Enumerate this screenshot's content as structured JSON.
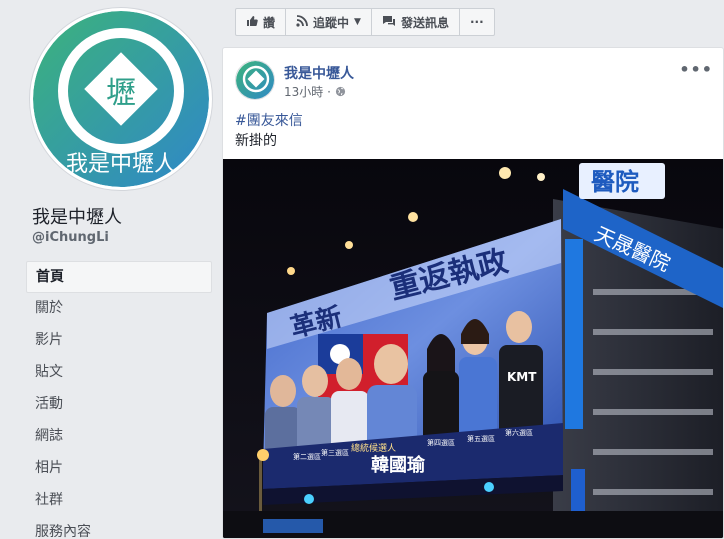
{
  "page": {
    "name": "我是中壢人",
    "handle": "@iChungLi",
    "logo_text": "我是中壢人",
    "logo_char": "壢"
  },
  "nav": {
    "items": [
      {
        "label": "首頁",
        "active": true
      },
      {
        "label": "關於"
      },
      {
        "label": "影片"
      },
      {
        "label": "貼文"
      },
      {
        "label": "活動"
      },
      {
        "label": "網誌"
      },
      {
        "label": "相片"
      },
      {
        "label": "社群"
      },
      {
        "label": "服務內容"
      }
    ]
  },
  "actions": {
    "like": "讚",
    "follow": "追蹤中",
    "message": "發送訊息",
    "more": "···"
  },
  "post": {
    "author": "我是中壢人",
    "time": "13小時",
    "hashtag": "#團友來信",
    "text": "新掛的",
    "more": "•••"
  },
  "photo": {
    "hospital_sign": "醫院",
    "building_banner": "天晟醫院",
    "slogan_left": "革新",
    "slogan_right": "重返執政",
    "candidate_name": "韓國瑜",
    "candidate_label": "總統候選人",
    "shirt_text": "KMT",
    "districts": [
      "第一選區",
      "第二選區",
      "第三選區",
      "第四選區",
      "第五選區",
      "第六選區"
    ],
    "names": [
      "鄭"
    ]
  },
  "colors": {
    "accent": "#385898",
    "logo_green": "#3fae7a",
    "logo_blue": "#2e8fc4",
    "billboard_blue": "#2455b8"
  }
}
